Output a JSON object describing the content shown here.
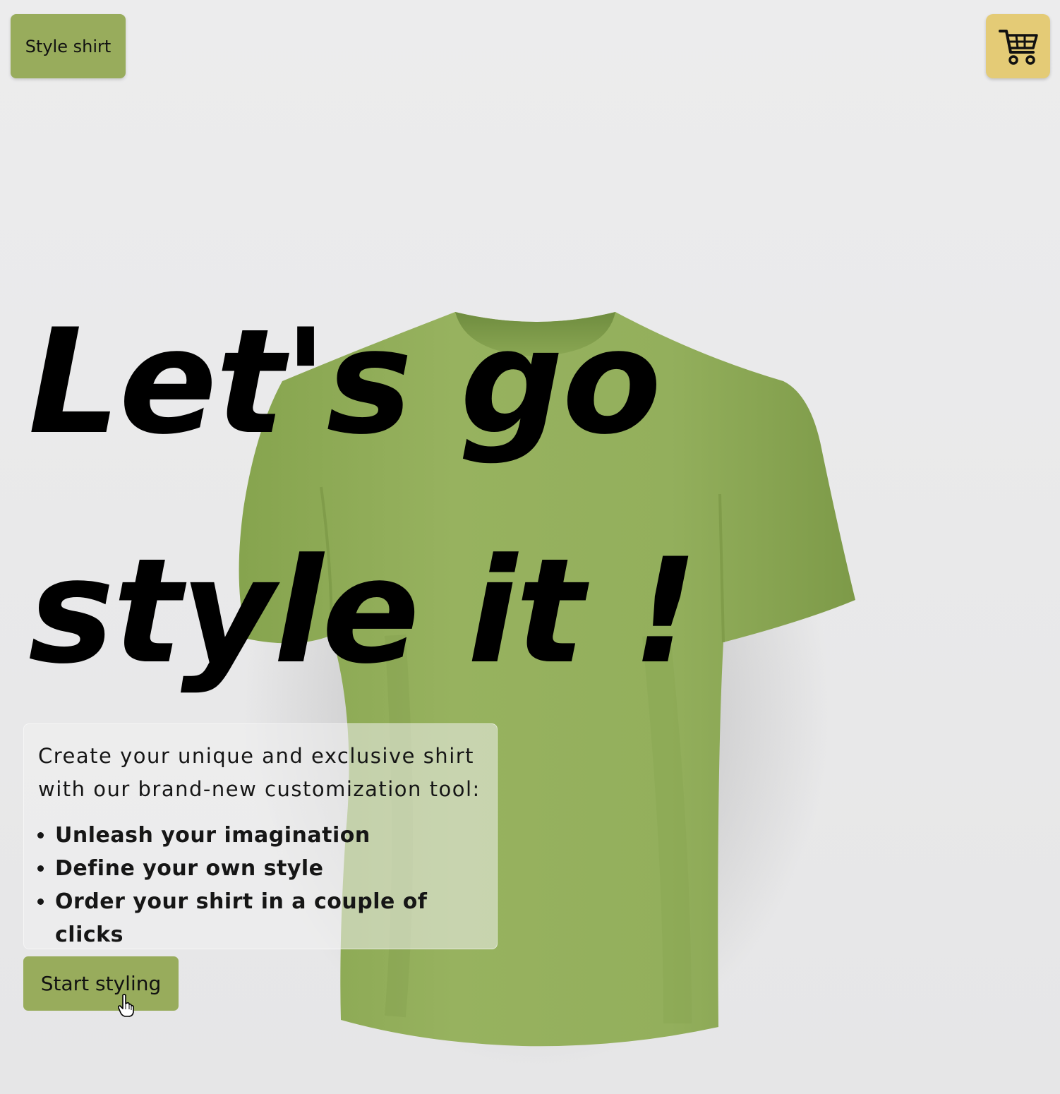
{
  "header": {
    "style_shirt_label": "Style shirt",
    "cart_icon": "shopping-cart-icon"
  },
  "hero": {
    "headline_line1": "Let's go",
    "headline_line2": "style it !"
  },
  "info": {
    "intro": "Create your unique and exclusive shirt with our brand-new customization tool:",
    "features": [
      "Unleash your imagination",
      "Define your own style",
      "Order your shirt in a couple of clicks"
    ]
  },
  "cta": {
    "label": "Start styling"
  },
  "colors": {
    "shirt": "#94b05c",
    "primary_button": "#98ac5c",
    "cart_button": "#e4cb76",
    "background": "#e9e9ea"
  }
}
